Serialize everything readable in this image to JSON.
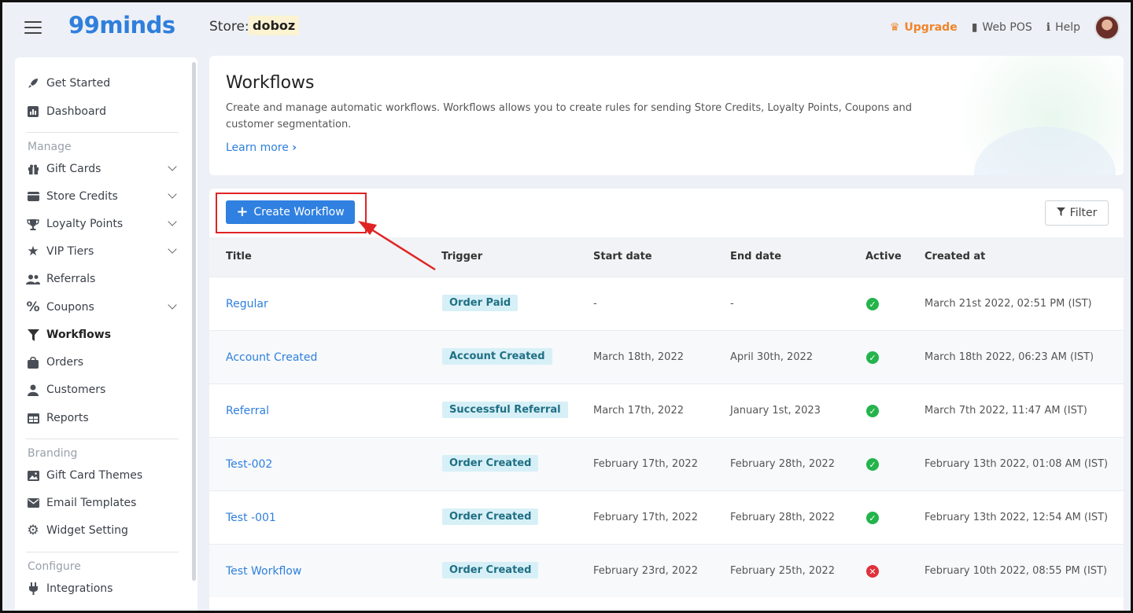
{
  "app": {
    "logo": "99minds",
    "store_label": "Store:",
    "store_name": "doboz"
  },
  "topbar": {
    "upgrade": "Upgrade",
    "web_pos": "Web POS",
    "help": "Help"
  },
  "sidebar": {
    "items_top": [
      {
        "label": "Get Started",
        "icon": "rocket-icon"
      },
      {
        "label": "Dashboard",
        "icon": "chart-icon"
      }
    ],
    "section_manage": "Manage",
    "items_manage": [
      {
        "label": "Gift Cards",
        "icon": "gift-icon",
        "expandable": true
      },
      {
        "label": "Store Credits",
        "icon": "wallet-icon",
        "expandable": true
      },
      {
        "label": "Loyalty Points",
        "icon": "trophy-icon",
        "expandable": true
      },
      {
        "label": "VIP Tiers",
        "icon": "star-icon",
        "expandable": true
      },
      {
        "label": "Referrals",
        "icon": "users-icon",
        "expandable": false
      },
      {
        "label": "Coupons",
        "icon": "percent-icon",
        "expandable": true
      },
      {
        "label": "Workflows",
        "icon": "funnel-icon",
        "expandable": false,
        "active": true
      },
      {
        "label": "Orders",
        "icon": "bag-icon",
        "expandable": false
      },
      {
        "label": "Customers",
        "icon": "user-icon",
        "expandable": false
      },
      {
        "label": "Reports",
        "icon": "table-icon",
        "expandable": false
      }
    ],
    "section_branding": "Branding",
    "items_branding": [
      {
        "label": "Gift Card Themes",
        "icon": "image-icon"
      },
      {
        "label": "Email Templates",
        "icon": "envelope-icon"
      },
      {
        "label": "Widget Setting",
        "icon": "gear-icon"
      }
    ],
    "section_configure": "Configure",
    "items_configure": [
      {
        "label": "Integrations",
        "icon": "plug-icon"
      }
    ]
  },
  "header": {
    "title": "Workflows",
    "description": "Create and manage automatic workflows. Workflows allows you to create rules for sending Store Credits, Loyalty Points, Coupons and customer segmentation.",
    "learn_more": "Learn more"
  },
  "toolbar": {
    "create_label": "Create Workflow",
    "filter_label": "Filter"
  },
  "table": {
    "columns": [
      "Title",
      "Trigger",
      "Start date",
      "End date",
      "Active",
      "Created at"
    ],
    "rows": [
      {
        "title": "Regular",
        "trigger": "Order Paid",
        "start": "-",
        "end": "-",
        "active": true,
        "created": "March 21st 2022, 02:51 PM (IST)"
      },
      {
        "title": "Account Created",
        "trigger": "Account Created",
        "start": "March 18th, 2022",
        "end": "April 30th, 2022",
        "active": true,
        "created": "March 18th 2022, 06:23 AM (IST)"
      },
      {
        "title": "Referral",
        "trigger": "Successful Referral",
        "start": "March 17th, 2022",
        "end": "January 1st, 2023",
        "active": true,
        "created": "March 7th 2022, 11:47 AM (IST)"
      },
      {
        "title": "Test-002",
        "trigger": "Order Created",
        "start": "February 17th, 2022",
        "end": "February 28th, 2022",
        "active": true,
        "created": "February 13th 2022, 01:08 AM (IST)"
      },
      {
        "title": "Test -001",
        "trigger": "Order Created",
        "start": "February 17th, 2022",
        "end": "February 28th, 2022",
        "active": true,
        "created": "February 13th 2022, 12:54 AM (IST)"
      },
      {
        "title": "Test Workflow",
        "trigger": "Order Created",
        "start": "February 23rd, 2022",
        "end": "February 25th, 2022",
        "active": false,
        "created": "February 10th 2022, 08:55 PM (IST)"
      }
    ]
  },
  "colors": {
    "brand": "#2f7fdc",
    "upgrade": "#f0842a",
    "active_ok": "#24b44c",
    "active_bad": "#e0323c",
    "highlight": "#e02424"
  }
}
